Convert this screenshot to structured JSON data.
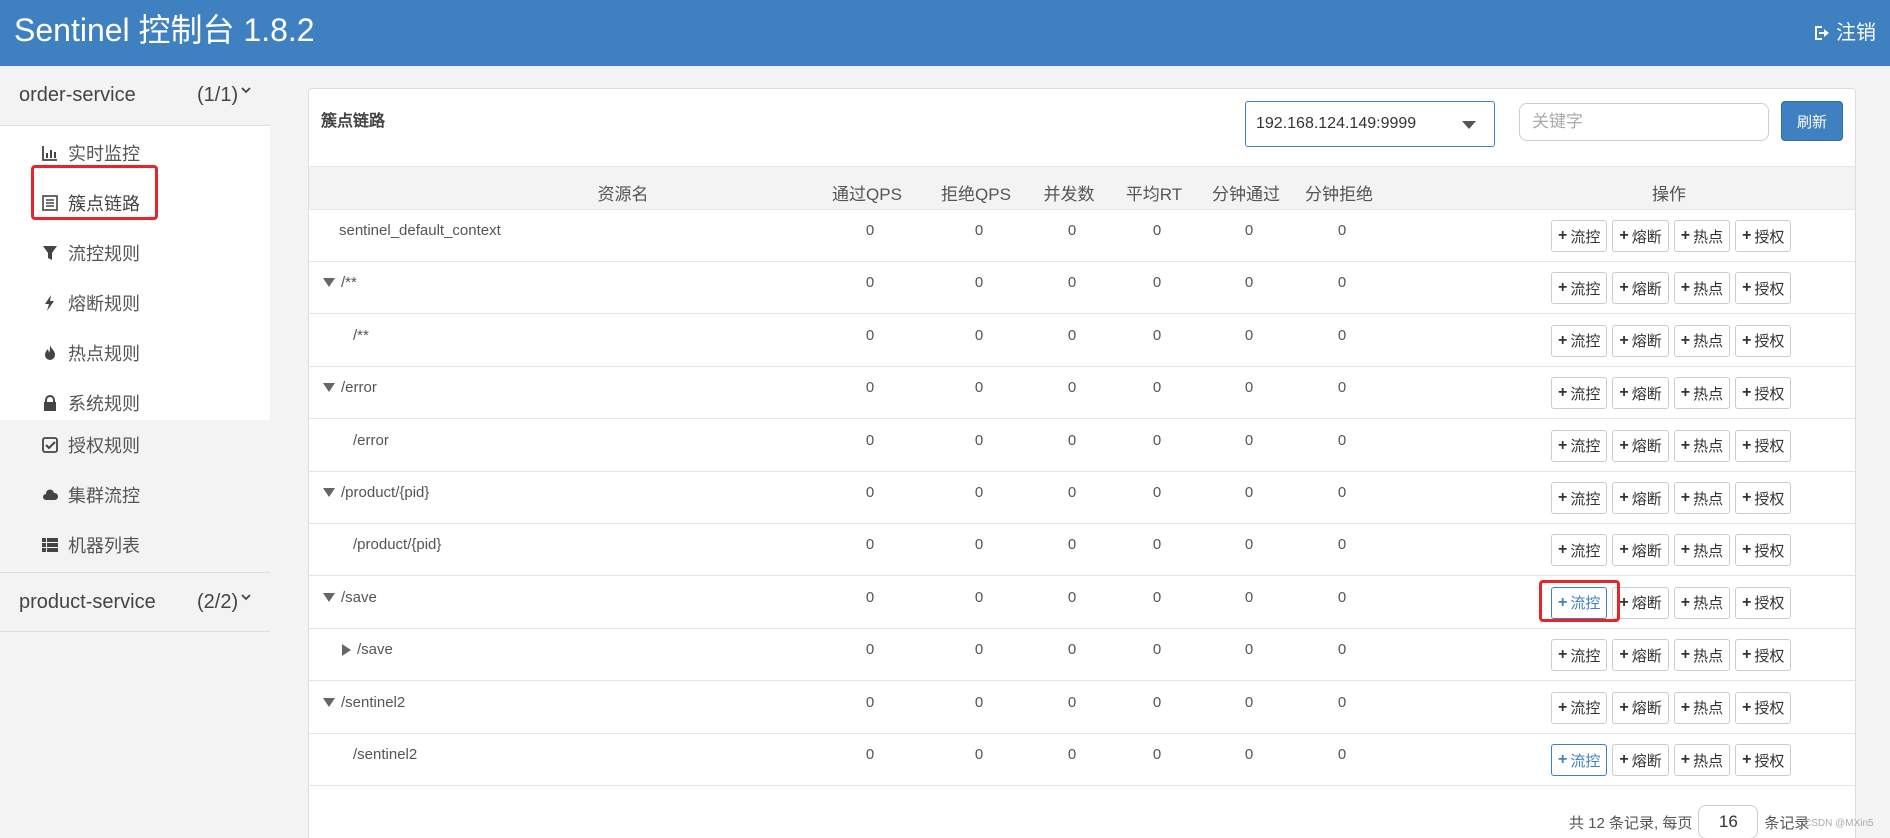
{
  "header": {
    "title": "Sentinel 控制台 1.8.2",
    "logout": "注销"
  },
  "sidebar": {
    "services": [
      {
        "name": "order-service",
        "count": "(1/1)"
      },
      {
        "name": "product-service",
        "count": "(2/2)"
      }
    ],
    "menu": [
      {
        "label": "实时监控",
        "icon": "bar-chart-icon"
      },
      {
        "label": "簇点链路",
        "icon": "list-icon"
      },
      {
        "label": "流控规则",
        "icon": "filter-icon"
      },
      {
        "label": "熔断规则",
        "icon": "bolt-icon"
      },
      {
        "label": "热点规则",
        "icon": "fire-icon"
      },
      {
        "label": "系统规则",
        "icon": "lock-icon"
      },
      {
        "label": "授权规则",
        "icon": "check-square-icon"
      },
      {
        "label": "集群流控",
        "icon": "cloud-icon"
      },
      {
        "label": "机器列表",
        "icon": "th-list-icon"
      }
    ]
  },
  "panel": {
    "title": "簇点链路",
    "machine": "192.168.124.149:9999",
    "search_placeholder": "关键字",
    "refresh": "刷新"
  },
  "table": {
    "headers": [
      "资源名",
      "通过QPS",
      "拒绝QPS",
      "并发数",
      "平均RT",
      "分钟通过",
      "分钟拒绝",
      "操作"
    ],
    "rows": [
      {
        "name": "sentinel_default_context",
        "toggle": "none",
        "values": [
          "0",
          "0",
          "0",
          "0",
          "0",
          "0"
        ]
      },
      {
        "name": "/**",
        "toggle": "down",
        "values": [
          "0",
          "0",
          "0",
          "0",
          "0",
          "0"
        ]
      },
      {
        "name": "/**",
        "toggle": "none",
        "values": [
          "0",
          "0",
          "0",
          "0",
          "0",
          "0"
        ]
      },
      {
        "name": "/error",
        "toggle": "down",
        "values": [
          "0",
          "0",
          "0",
          "0",
          "0",
          "0"
        ]
      },
      {
        "name": "/error",
        "toggle": "none",
        "values": [
          "0",
          "0",
          "0",
          "0",
          "0",
          "0"
        ]
      },
      {
        "name": "/product/{pid}",
        "toggle": "down",
        "values": [
          "0",
          "0",
          "0",
          "0",
          "0",
          "0"
        ]
      },
      {
        "name": "/product/{pid}",
        "toggle": "none",
        "values": [
          "0",
          "0",
          "0",
          "0",
          "0",
          "0"
        ]
      },
      {
        "name": "/save",
        "toggle": "down",
        "values": [
          "0",
          "0",
          "0",
          "0",
          "0",
          "0"
        ]
      },
      {
        "name": "/save",
        "toggle": "right",
        "values": [
          "0",
          "0",
          "0",
          "0",
          "0",
          "0"
        ]
      },
      {
        "name": "/sentinel2",
        "toggle": "down",
        "values": [
          "0",
          "0",
          "0",
          "0",
          "0",
          "0"
        ]
      },
      {
        "name": "/sentinel2",
        "toggle": "none",
        "values": [
          "0",
          "0",
          "0",
          "0",
          "0",
          "0"
        ]
      }
    ],
    "actions": [
      "流控",
      "熔断",
      "热点",
      "授权"
    ]
  },
  "pager": {
    "prefix": "共 12 条记录, 每页",
    "size": "16",
    "suffix": "条记录"
  },
  "watermark": "CSDN @MXin5",
  "colors": {
    "brand": "#3f80c1",
    "highlight": "#e8242a"
  }
}
